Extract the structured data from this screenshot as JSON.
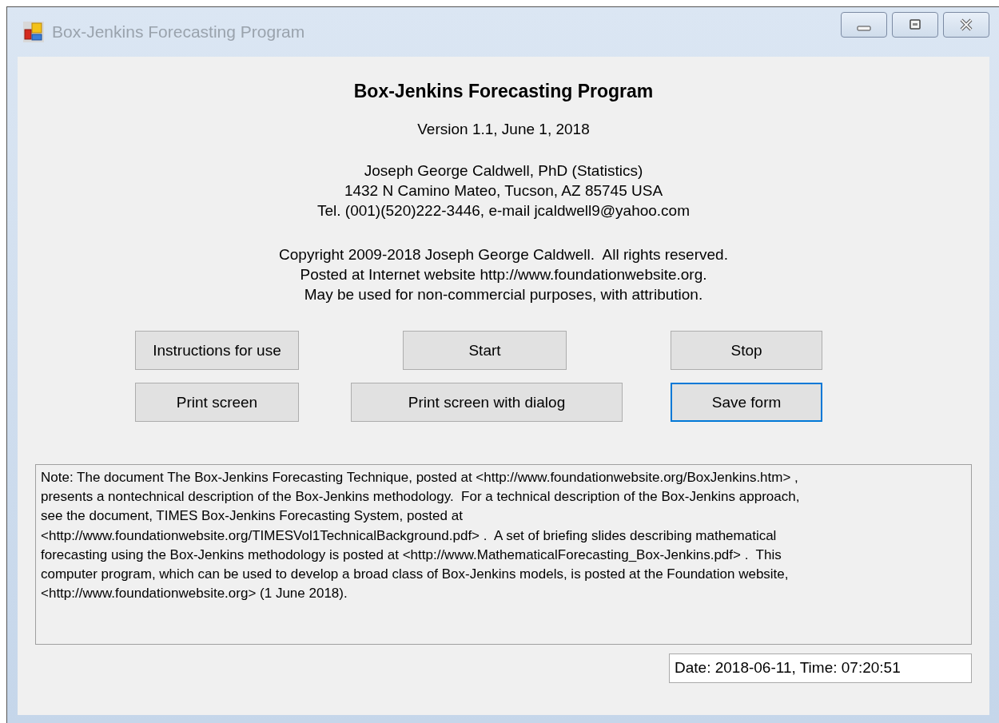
{
  "window": {
    "title": "Box-Jenkins Forecasting Program"
  },
  "header": {
    "title": "Box-Jenkins Forecasting Program",
    "version": "Version 1.1, June 1, 2018",
    "author_lines": [
      "Joseph George Caldwell, PhD (Statistics)",
      "1432 N Camino Mateo, Tucson, AZ 85745 USA",
      "Tel. (001)(520)222-3446, e-mail jcaldwell9@yahoo.com"
    ],
    "copyright_lines": [
      "Copyright 2009-2018 Joseph George Caldwell.  All rights reserved.",
      "Posted at Internet website http://www.foundationwebsite.org.",
      "May be used for non-commercial purposes, with attribution."
    ]
  },
  "buttons": [
    [
      {
        "label": "Instructions for use",
        "focused": false
      },
      {
        "label": "Start",
        "focused": false
      },
      {
        "label": "Stop",
        "focused": false
      }
    ],
    [
      {
        "label": "Print screen",
        "focused": false
      },
      {
        "label": "Print screen with dialog",
        "focused": false
      },
      {
        "label": "Save form",
        "focused": true
      }
    ]
  ],
  "note": {
    "lines": [
      "Note: The document The Box-Jenkins Forecasting Technique, posted at <http://www.foundationwebsite.org/BoxJenkins.htm> ,",
      "presents a nontechnical description of the Box-Jenkins methodology.  For a technical description of the Box-Jenkins approach,",
      "see the document, TIMES Box-Jenkins Forecasting System, posted at",
      "<http://www.foundationwebsite.org/TIMESVol1TechnicalBackground.pdf> .  A set of briefing slides describing mathematical",
      "forecasting using the Box-Jenkins methodology is posted at <http://www.MathematicalForecasting_Box-Jenkins.pdf> .  This",
      "computer program, which can be used to develop a broad class of Box-Jenkins models, is posted at the Foundation website,",
      "<http://www.foundationwebsite.org> (1 June 2018)."
    ]
  },
  "datetime": {
    "value": "Date: 2018-06-11, Time: 07:20:51"
  }
}
